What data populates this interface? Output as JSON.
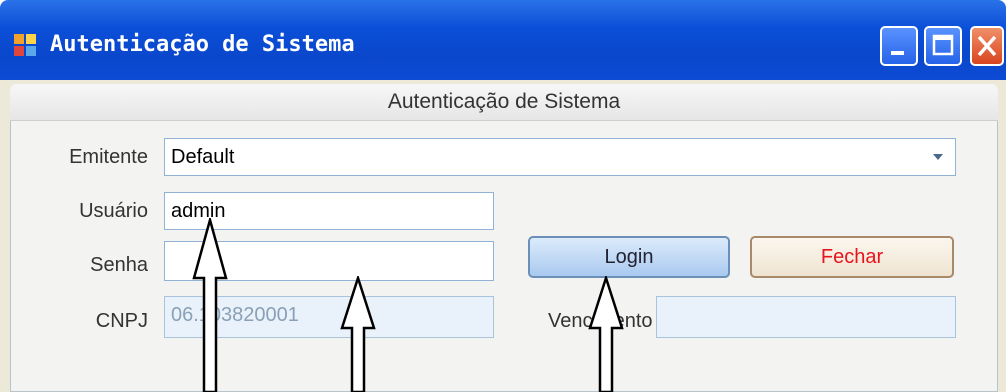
{
  "window": {
    "title": "Autenticação de Sistema",
    "header": "Autenticação de Sistema"
  },
  "form": {
    "emitente_label": "Emitente",
    "emitente_value": "Default",
    "usuario_label": "Usuário",
    "usuario_value": "admin",
    "senha_label": "Senha",
    "senha_value": "",
    "cnpj_label": "CNPJ",
    "cnpj_value": "06.103820001",
    "vencimento_label": "Vencimento",
    "vencimento_value": ""
  },
  "buttons": {
    "login": "Login",
    "fechar": "Fechar"
  },
  "colors": {
    "titlebar": "#0b4fd8",
    "fechar_text": "#e8141e"
  }
}
